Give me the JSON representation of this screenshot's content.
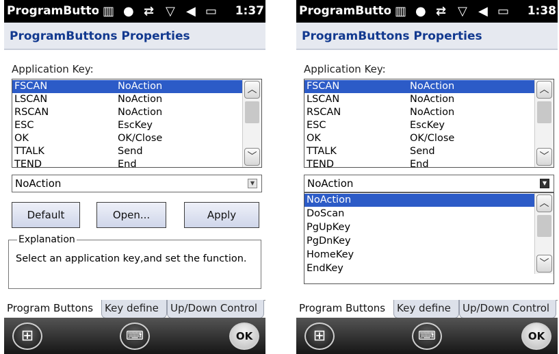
{
  "screens": [
    {
      "app_title": "ProgramButtons",
      "time": "1:37",
      "page_title": "ProgramButtons Properties",
      "app_key_label": "Application Key:",
      "keys": [
        {
          "key": "FSCAN",
          "action": "NoAction",
          "selected": true
        },
        {
          "key": "LSCAN",
          "action": "NoAction"
        },
        {
          "key": "RSCAN",
          "action": "NoAction"
        },
        {
          "key": "ESC",
          "action": "EscKey"
        },
        {
          "key": "OK",
          "action": "OK/Close"
        },
        {
          "key": "TTALK",
          "action": "Send"
        },
        {
          "key": "TEND",
          "action": "End"
        }
      ],
      "combo_value": "NoAction",
      "buttons": {
        "default": "Default",
        "open": "Open...",
        "apply": "Apply"
      },
      "explanation_title": "Explanation",
      "explanation_text": "Select an application key,and set the function.",
      "tabs": [
        "Program Buttons",
        "Key define",
        "Up/Down Control"
      ],
      "softkeys": {
        "ok": "OK"
      }
    },
    {
      "app_title": "ProgramButtons",
      "time": "1:38",
      "page_title": "ProgramButtons Properties",
      "app_key_label": "Application Key:",
      "keys": [
        {
          "key": "FSCAN",
          "action": "NoAction",
          "selected": true
        },
        {
          "key": "LSCAN",
          "action": "NoAction"
        },
        {
          "key": "RSCAN",
          "action": "NoAction"
        },
        {
          "key": "ESC",
          "action": "EscKey"
        },
        {
          "key": "OK",
          "action": "OK/Close"
        },
        {
          "key": "TTALK",
          "action": "Send"
        },
        {
          "key": "TEND",
          "action": "End"
        }
      ],
      "combo_value": "NoAction",
      "dropdown_options": [
        "NoAction",
        "DoScan",
        "PgUpKey",
        "PgDnKey",
        "HomeKey",
        "EndKey"
      ],
      "dropdown_selected": "NoAction",
      "tabs": [
        "Program Buttons",
        "Key define",
        "Up/Down Control"
      ],
      "softkeys": {
        "ok": "OK"
      }
    }
  ]
}
